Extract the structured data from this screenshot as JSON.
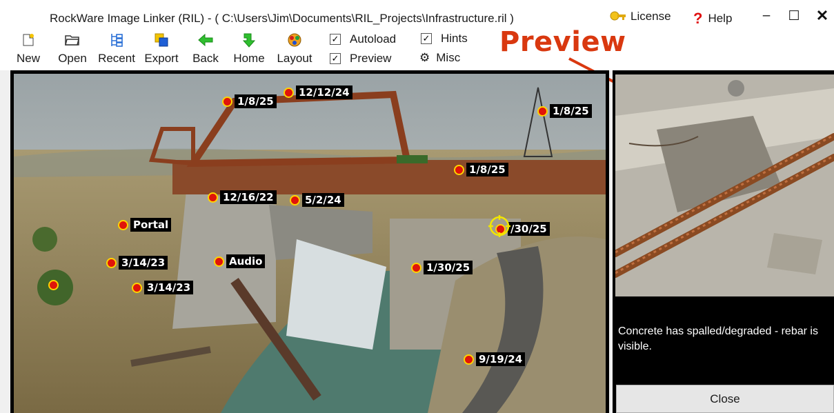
{
  "window": {
    "title": "RockWare Image Linker (RIL) - ( C:\\Users\\Jim\\Documents\\RIL_Projects\\Infrastructure.ril )",
    "license_label": "License",
    "help_label": "Help",
    "minimize_glyph": "–",
    "maximize_glyph": "☐",
    "close_glyph": "✕"
  },
  "toolbar": {
    "buttons": [
      {
        "label": "New",
        "icon": "new-file-icon"
      },
      {
        "label": "Open",
        "icon": "folder-open-icon"
      },
      {
        "label": "Recent",
        "icon": "recent-tree-icon"
      },
      {
        "label": "Export",
        "icon": "export-icon"
      },
      {
        "label": "Back",
        "icon": "back-arrow-icon"
      },
      {
        "label": "Home",
        "icon": "home-arrow-icon"
      },
      {
        "label": "Layout",
        "icon": "layout-icon"
      }
    ],
    "checkboxes": [
      {
        "label": "Autoload",
        "checked": true
      },
      {
        "label": "Preview",
        "checked": true
      },
      {
        "label": "Hints",
        "checked": true
      }
    ],
    "misc_label": "Misc"
  },
  "callout": {
    "text": "Preview",
    "color": "#d9380f"
  },
  "markers": [
    {
      "label": "1/8/25"
    },
    {
      "label": "12/12/24"
    },
    {
      "label": "1/8/25"
    },
    {
      "label": "1/8/25"
    },
    {
      "label": "12/16/22"
    },
    {
      "label": "5/2/24"
    },
    {
      "label": "Portal"
    },
    {
      "label": "/30/25"
    },
    {
      "label": "3/14/23"
    },
    {
      "label": "Audio"
    },
    {
      "label": "1/30/25"
    },
    {
      "label": "3/14/23"
    },
    {
      "label": ""
    },
    {
      "label": "9/19/24"
    }
  ],
  "preview": {
    "description": "Concrete has spalled/degraded - rebar is visible.",
    "close_label": "Close"
  },
  "colors": {
    "marker_fill": "#e0140a",
    "marker_ring": "#ffd400",
    "selected_ring": "#f2e600"
  }
}
